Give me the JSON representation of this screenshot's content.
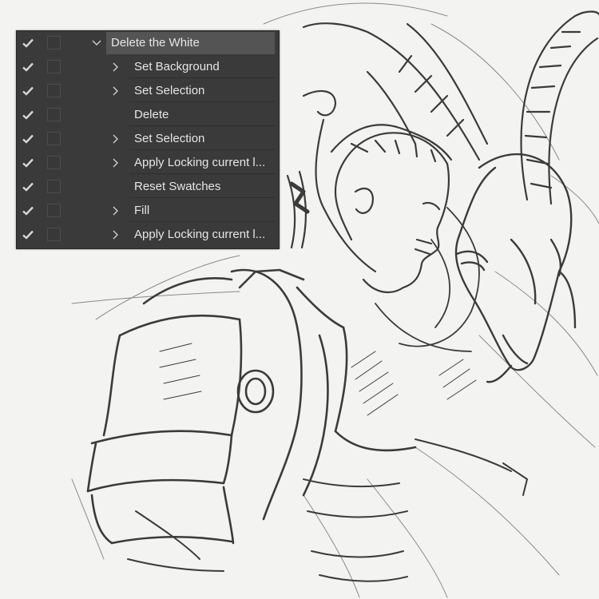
{
  "actions_panel": {
    "group": {
      "label": "Delete the White",
      "enabled": true,
      "expanded": true,
      "expand_icon": "chevron-down-icon"
    },
    "steps": [
      {
        "label": "Set Background",
        "enabled": true,
        "expandable": true
      },
      {
        "label": "Set Selection",
        "enabled": true,
        "expandable": true
      },
      {
        "label": "Delete",
        "enabled": true,
        "expandable": false
      },
      {
        "label": "Set Selection",
        "enabled": true,
        "expandable": true
      },
      {
        "label": "Apply Locking current l...",
        "enabled": true,
        "expandable": true
      },
      {
        "label": "Reset Swatches",
        "enabled": true,
        "expandable": false
      },
      {
        "label": "Fill",
        "enabled": true,
        "expandable": true
      },
      {
        "label": "Apply Locking current l...",
        "enabled": true,
        "expandable": true
      }
    ],
    "colors": {
      "panel_bg": "#3a3a3a",
      "selected_row_bg": "#545454",
      "text": "#e6e6e6",
      "checkmark": "#d8d8d8"
    }
  },
  "canvas": {
    "content": "pencil-sketch-artwork"
  }
}
